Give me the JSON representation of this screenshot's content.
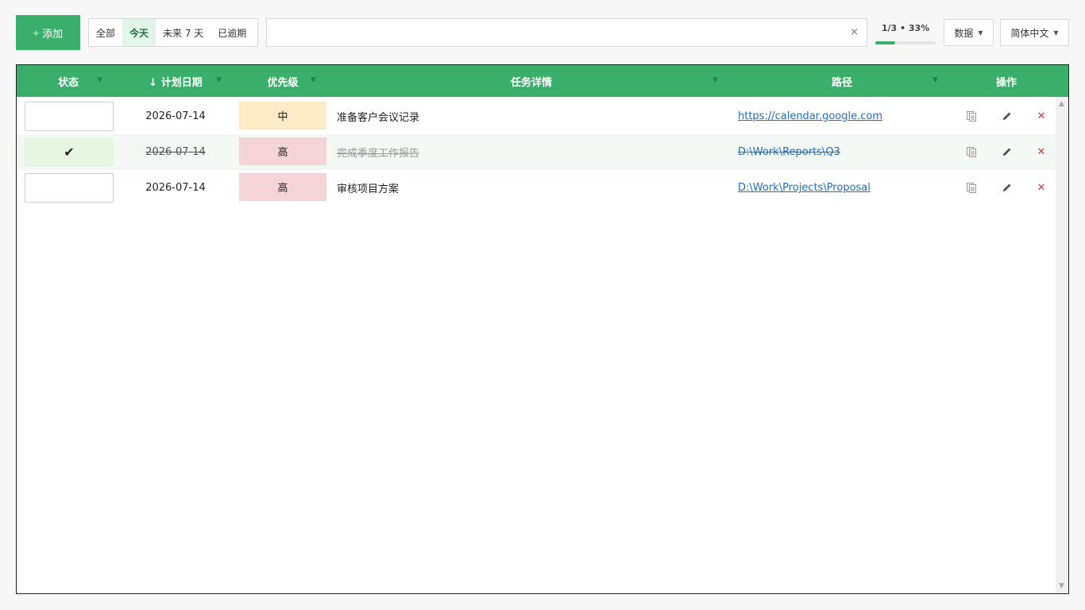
{
  "toolbar": {
    "add_label": "添加",
    "filters": [
      {
        "label": "全部",
        "active": false
      },
      {
        "label": "今天",
        "active": true
      },
      {
        "label": "未来 7 天",
        "active": false
      },
      {
        "label": "已逾期",
        "active": false
      }
    ],
    "search_value": "",
    "search_clear": "×",
    "progress_text": "1/3 • 33%",
    "progress_fraction": 0.33,
    "data_menu": "数据",
    "language_menu": "简体中文"
  },
  "table": {
    "headers": {
      "status": "状态",
      "date": "↓ 计划日期",
      "priority": "优先级",
      "detail": "任务详情",
      "path": "路径",
      "actions": "操作"
    },
    "rows": [
      {
        "status_mark": "",
        "date": "2026-07-14",
        "priority": "中",
        "priority_color": "#fdebc8",
        "detail": "准备客户会议记录",
        "path": "https://calendar.google.com",
        "done": false
      },
      {
        "status_mark": "✔",
        "date": "2026-07-14",
        "priority": "高",
        "priority_color": "#f4d4d6",
        "detail": "完成季度工作报告",
        "path": "D:\\Work\\Reports\\Q3",
        "done": true
      },
      {
        "status_mark": "",
        "date": "2026-07-14",
        "priority": "高",
        "priority_color": "#f4d4d6",
        "detail": "审核项目方案",
        "path": "D:\\Work\\Projects\\Proposal",
        "done": false
      }
    ]
  },
  "colors": {
    "accent": "#3aae6b",
    "link": "#1a6fc4",
    "delete": "#d23c3c"
  }
}
